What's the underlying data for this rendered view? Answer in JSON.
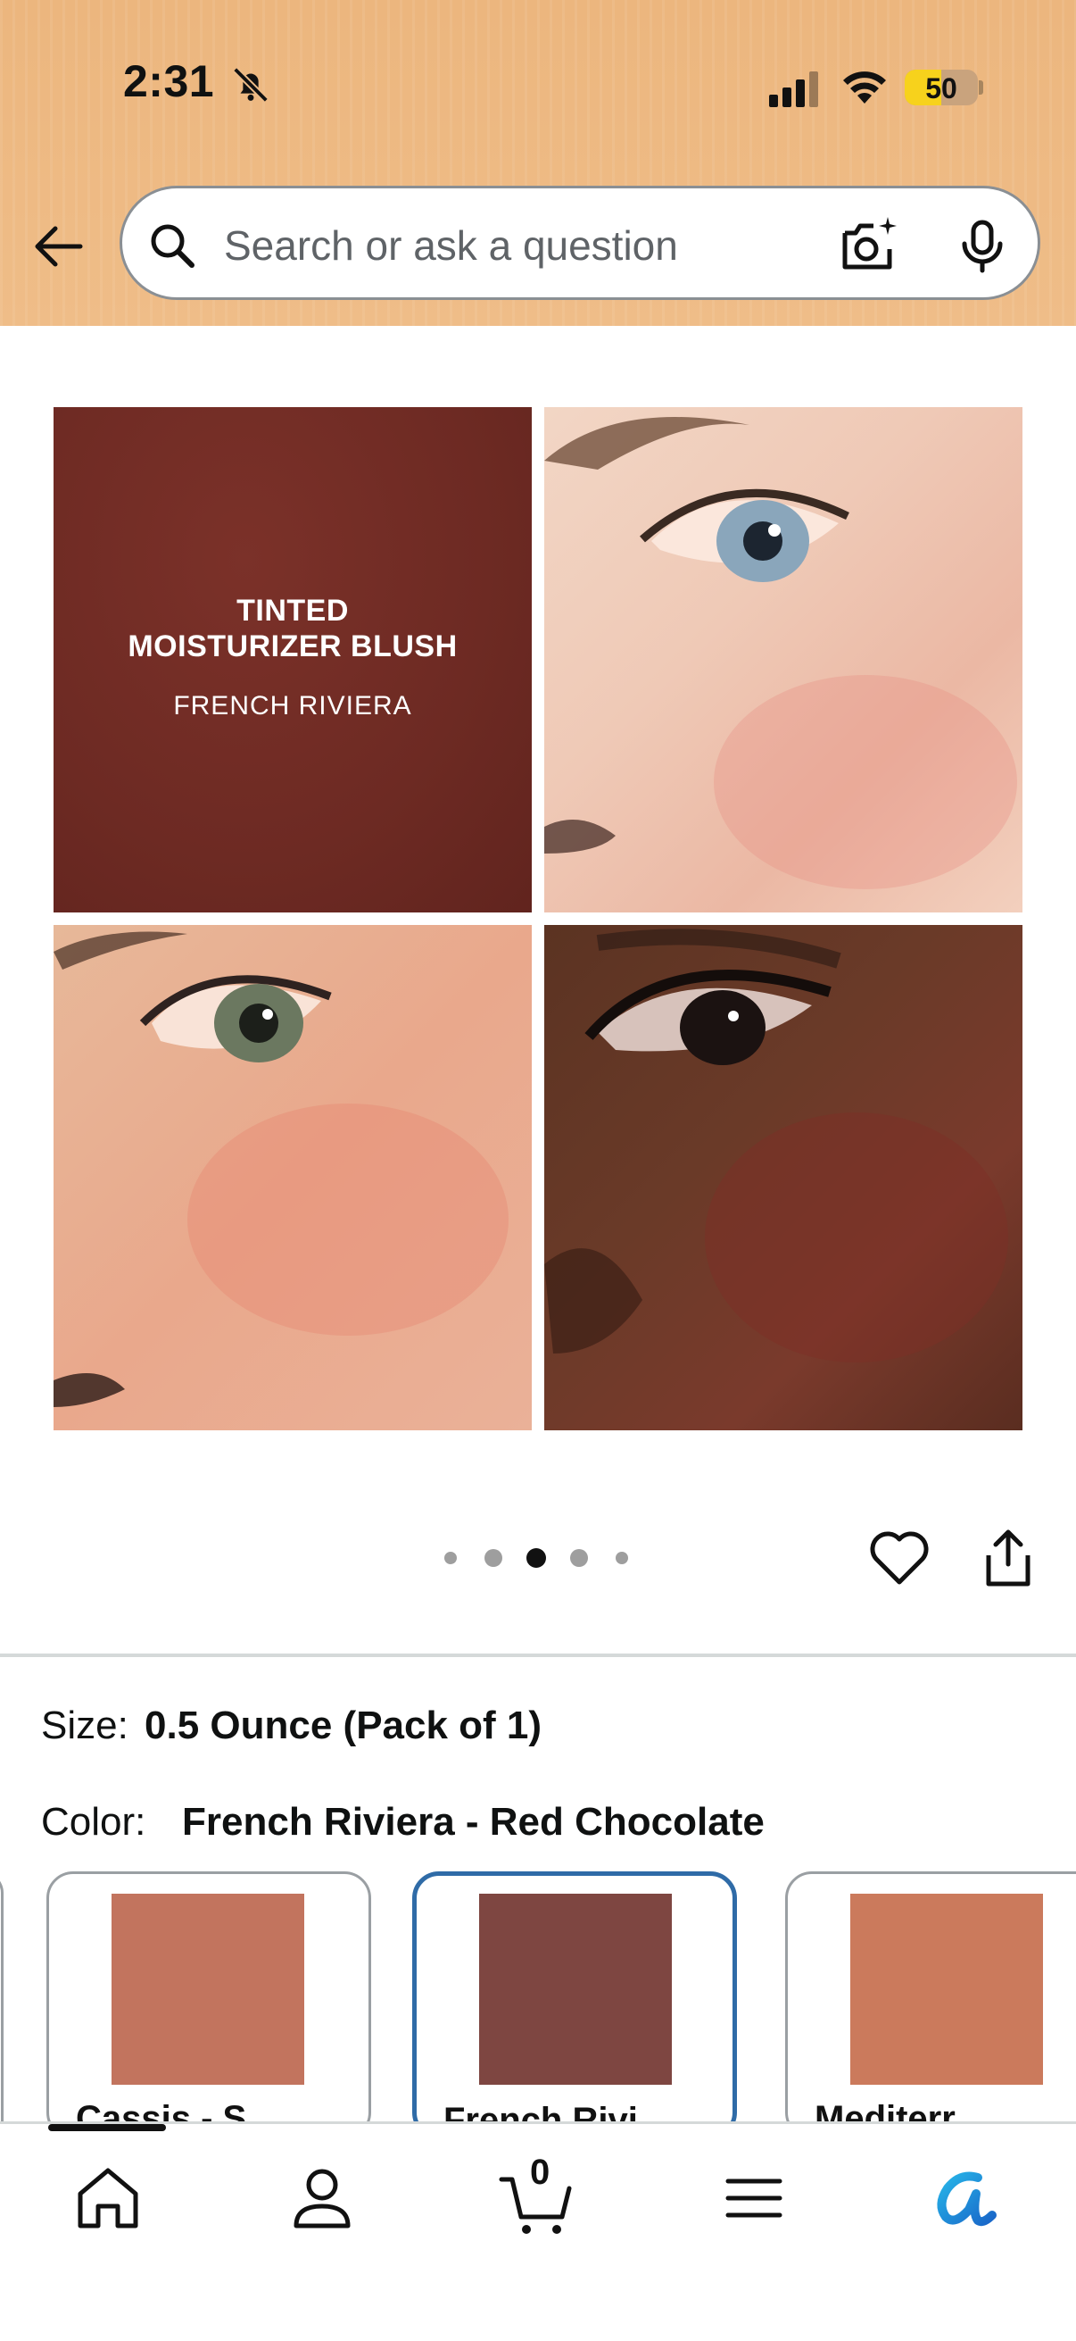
{
  "status_bar": {
    "time": "2:31",
    "battery": "50",
    "battery_level": 0.5
  },
  "search": {
    "placeholder": "Search or ask a question"
  },
  "gallery": {
    "tile_title_line1": "TINTED",
    "tile_title_line2": "MOISTURIZER BLUSH",
    "tile_subtitle": "FRENCH RIVIERA",
    "page_count": 5,
    "active_page": 3
  },
  "variations": {
    "size_label": "Size:",
    "size_value": "0.5 Ounce (Pack of 1)",
    "color_label": "Color:",
    "color_value": "French Riviera - Red Chocolate",
    "swatches": [
      {
        "name": "Cassis - S...",
        "color": "#c2745e",
        "selected": false
      },
      {
        "name": "French Rivi...",
        "color": "#7e4641",
        "selected": true
      },
      {
        "name": "Mediterr...",
        "color": "#cb7a5c",
        "selected": false
      }
    ]
  },
  "bottom_nav": {
    "cart_count": "0",
    "items": [
      "home-icon",
      "account-icon",
      "cart-icon",
      "menu-icon",
      "rufus-icon"
    ]
  },
  "colors": {
    "header_bg": "#efbd88",
    "selected_border": "#2f6ba7",
    "rufus_accent": "#1a9ee3"
  }
}
